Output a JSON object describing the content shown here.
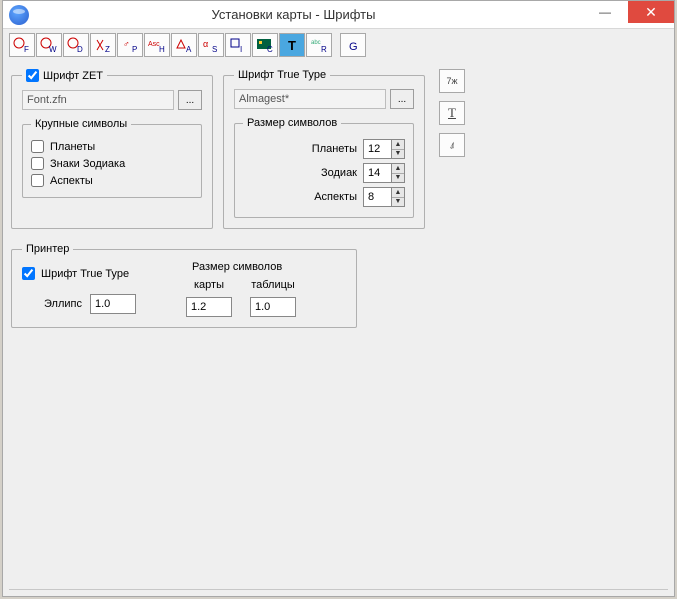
{
  "window": {
    "title": "Установки карты - Шрифты"
  },
  "toolbar": {
    "buttons": [
      {
        "name": "tb-1"
      },
      {
        "name": "tb-2"
      },
      {
        "name": "tb-3"
      },
      {
        "name": "tb-4"
      },
      {
        "name": "tb-5"
      },
      {
        "name": "tb-6"
      },
      {
        "name": "tb-7"
      },
      {
        "name": "tb-8"
      },
      {
        "name": "tb-9"
      },
      {
        "name": "tb-10"
      },
      {
        "name": "tb-11-active"
      },
      {
        "name": "tb-12"
      },
      {
        "name": "tb-13"
      }
    ]
  },
  "zet": {
    "legend": "Шрифт ZET",
    "font_value": "Font.zfn",
    "browse": "...",
    "large_symbols": {
      "legend": "Крупные символы",
      "planets": "Планеты",
      "zodiac": "Знаки Зодиака",
      "aspects": "Аспекты"
    }
  },
  "tt": {
    "legend": "Шрифт True Type",
    "font_value": "Almagest*",
    "browse": "...",
    "size_symbols": {
      "legend": "Размер символов",
      "planets_label": "Планеты",
      "planets_value": "12",
      "zodiac_label": "Зодиак",
      "zodiac_value": "14",
      "aspects_label": "Аспекты",
      "aspects_value": "8"
    }
  },
  "side": {
    "btn1": "7ж",
    "btn2": "T",
    "btn3": "⍋"
  },
  "printer": {
    "legend": "Принтер",
    "tt_label": "Шрифт True Type",
    "ellipse_label": "Эллипс",
    "ellipse_value": "1.0",
    "header": "Размер символов",
    "karta_label": "карты",
    "karta_value": "1.2",
    "table_label": "таблицы",
    "table_value": "1.0"
  }
}
